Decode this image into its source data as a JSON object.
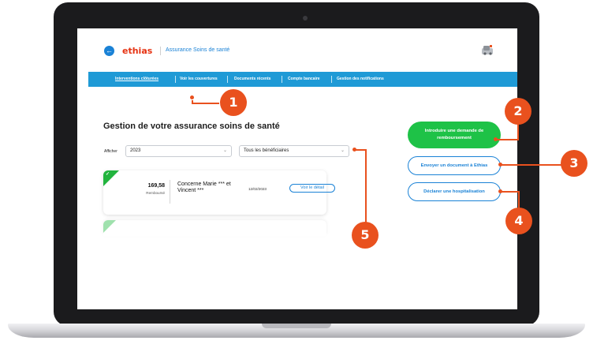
{
  "header": {
    "back_glyph": "←",
    "logo_text": "ethias",
    "app_title": "Assurance Soins de santé",
    "user_icon": "user-avatar-icon"
  },
  "nav": {
    "items": [
      {
        "label": "Interventions clôturées",
        "active": true
      },
      {
        "label": "Voir les couvertures",
        "active": false
      },
      {
        "label": "Documents récents",
        "active": false
      },
      {
        "label": "Compte bancaire",
        "active": false
      },
      {
        "label": "Gestion des notifications",
        "active": false
      }
    ]
  },
  "main": {
    "title": "Gestion de votre assurance soins de santé",
    "filter_label": "Afficher",
    "year_select": "2023",
    "beneficiary_select": "Tous les bénéficiaires",
    "card": {
      "amount": "169,58",
      "amount_label": "Remboursé",
      "concerne": "Concerne Marie *** et Vincent ***",
      "date": "12/02/2023",
      "detail_button": "Voir le détail",
      "check_glyph": "✓"
    }
  },
  "actions": {
    "primary": "Introduire une demande de remboursement",
    "send_doc": "Envoyer un document à Ethias",
    "hospital": "Déclarer une hospitalisation"
  },
  "callouts": [
    "1",
    "2",
    "3",
    "4",
    "5"
  ],
  "colors": {
    "accent_blue": "#1a82d6",
    "nav_blue": "#1f9ad6",
    "green": "#1ec247",
    "callout_orange": "#e9511e",
    "brand_red": "#e63312"
  }
}
